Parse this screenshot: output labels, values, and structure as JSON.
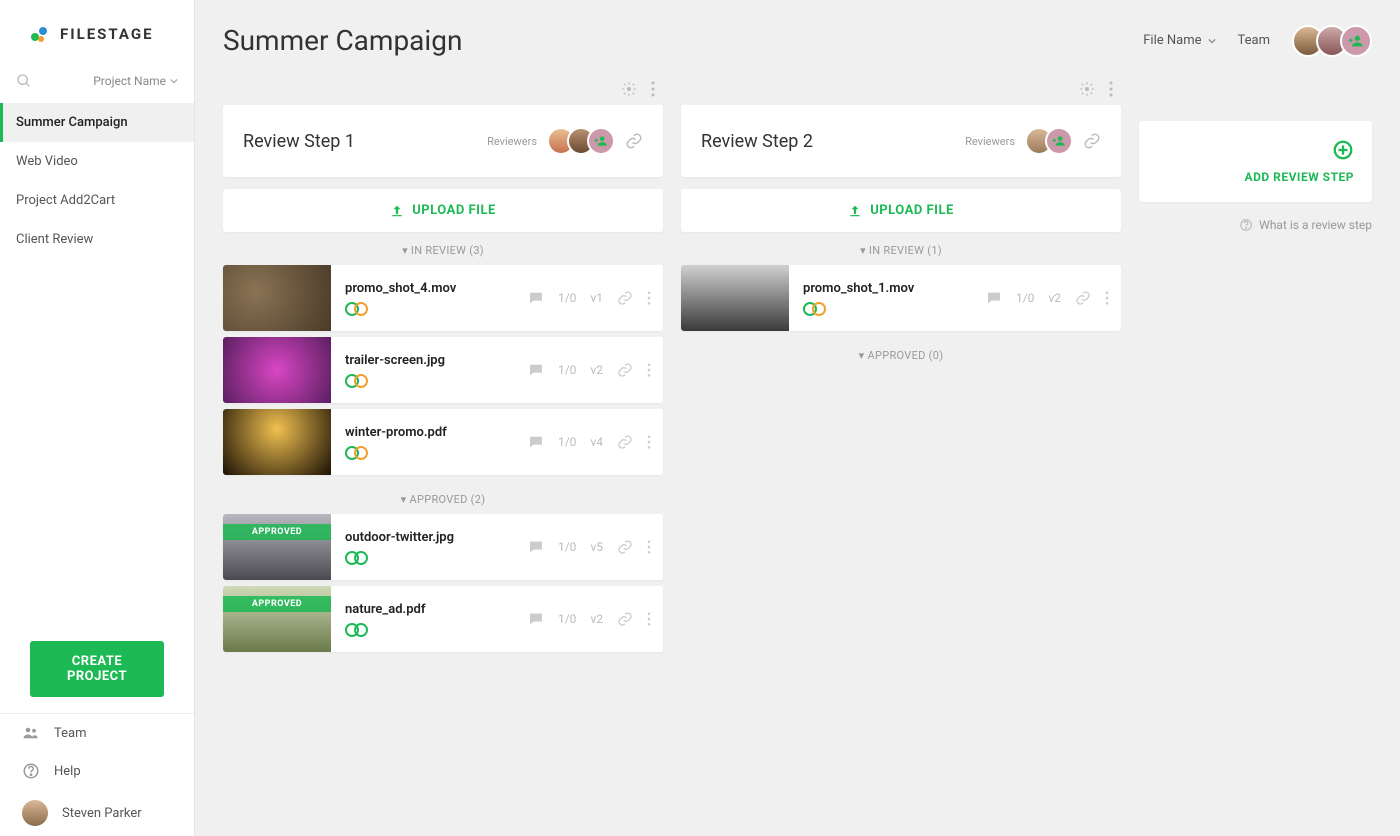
{
  "brand": "FILESTAGE",
  "sidebar": {
    "project_dropdown": "Project Name",
    "projects": [
      {
        "name": "Summer Campaign",
        "active": true
      },
      {
        "name": "Web Video",
        "active": false
      },
      {
        "name": "Project Add2Cart",
        "active": false
      },
      {
        "name": "Client Review",
        "active": false
      }
    ],
    "create_label": "CREATE PROJECT",
    "team_label": "Team",
    "help_label": "Help",
    "user_name": "Steven Parker"
  },
  "header": {
    "title": "Summer Campaign",
    "filename_label": "File Name",
    "team_label": "Team"
  },
  "steps": [
    {
      "title": "Review Step 1",
      "reviewers_label": "Reviewers",
      "upload_label": "UPLOAD FILE",
      "sections": [
        {
          "label": "IN REVIEW (3)",
          "files": [
            {
              "name": "promo_shot_4.mov",
              "comments": "1/0",
              "version": "v1",
              "status": "mixed",
              "thumb": "#6b5a48",
              "approved": false
            },
            {
              "name": "trailer-screen.jpg",
              "comments": "1/0",
              "version": "v2",
              "status": "mixed",
              "thumb": "#a04db0",
              "approved": false
            },
            {
              "name": "winter-promo.pdf",
              "comments": "1/0",
              "version": "v4",
              "status": "mixed",
              "thumb": "#2a1f10",
              "approved": false
            }
          ]
        },
        {
          "label": "APPROVED (2)",
          "files": [
            {
              "name": "outdoor-twitter.jpg",
              "comments": "1/0",
              "version": "v5",
              "status": "approved",
              "thumb": "#7a7a7d",
              "approved": true
            },
            {
              "name": "nature_ad.pdf",
              "comments": "1/0",
              "version": "v2",
              "status": "approved",
              "thumb": "#8a9a6a",
              "approved": true
            }
          ]
        }
      ]
    },
    {
      "title": "Review Step 2",
      "reviewers_label": "Reviewers",
      "upload_label": "UPLOAD FILE",
      "sections": [
        {
          "label": "IN REVIEW (1)",
          "files": [
            {
              "name": "promo_shot_1.mov",
              "comments": "1/0",
              "version": "v2",
              "status": "mixed",
              "thumb": "#6b6b6b",
              "approved": false
            }
          ]
        },
        {
          "label": "APPROVED (0)",
          "files": []
        }
      ]
    }
  ],
  "add_step_label": "ADD REVIEW STEP",
  "help_hint": "What is a review step",
  "approved_ribbon": "APPROVED"
}
